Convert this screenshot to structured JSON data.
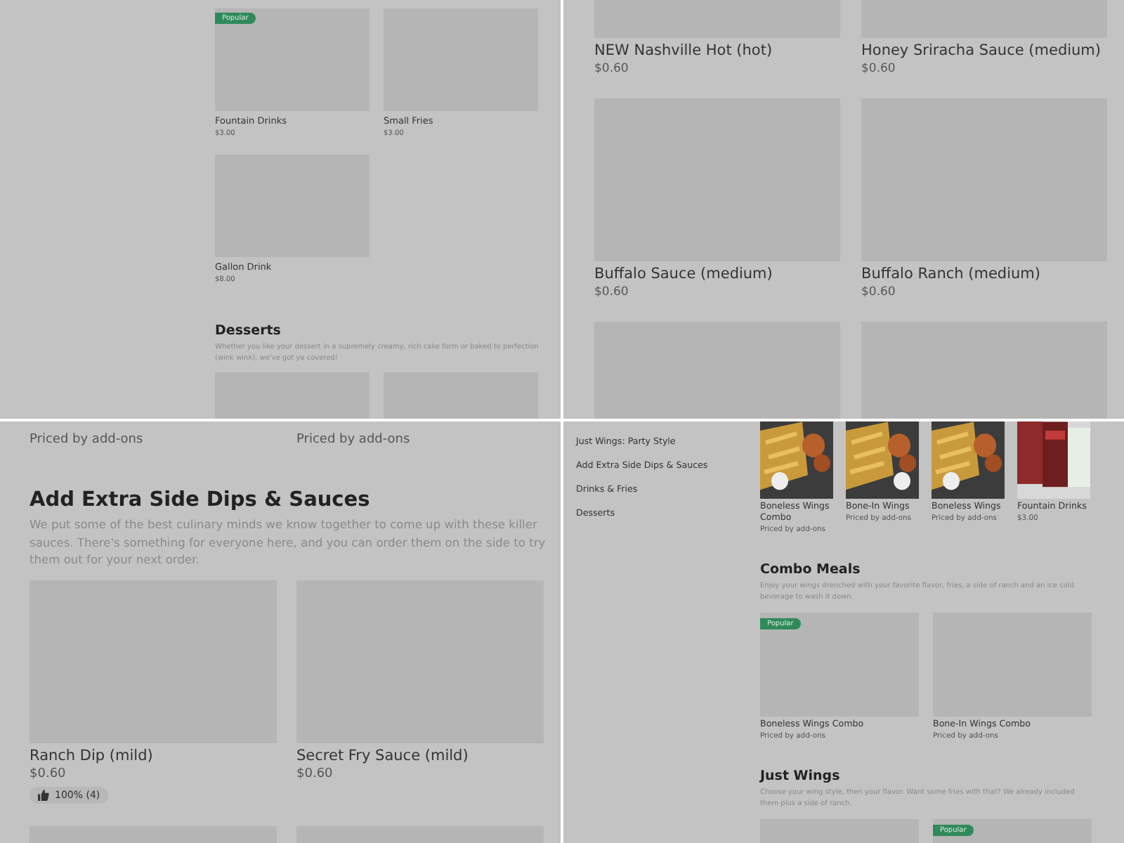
{
  "panels": [
    {
      "blocks": [
        {
          "kind": "cards",
          "items": [
            {
              "kind": "blank",
              "badge": "Popular",
              "title": "Fountain Drinks",
              "price": "$3.00"
            },
            {
              "kind": "blank",
              "title": "Small Fries",
              "price": "$3.00"
            },
            {
              "kind": "blank",
              "title": "Gallon Drink",
              "price": "$8.00"
            }
          ]
        },
        {
          "kind": "heading",
          "title": "Desserts",
          "description": "Whether you like your dessert in a supremely creamy, rich cake form or baked to perfection (wink wink), we've got ya covered!"
        },
        {
          "kind": "cards",
          "items": [
            {
              "kind": "blank"
            },
            {
              "kind": "blank"
            }
          ]
        }
      ]
    },
    {
      "blocks": [
        {
          "kind": "cards",
          "items": [
            {
              "kind": "blank",
              "title": "NEW Nashville Hot (hot)",
              "price": "$0.60"
            },
            {
              "kind": "blank",
              "title": "Honey Sriracha Sauce (medium)",
              "price": "$0.60"
            },
            {
              "kind": "blank",
              "title": "Buffalo Sauce (medium)",
              "price": "$0.60"
            },
            {
              "kind": "blank",
              "title": "Buffalo Ranch (medium)",
              "price": "$0.60"
            },
            {
              "kind": "blank"
            },
            {
              "kind": "blank"
            }
          ]
        }
      ]
    },
    {
      "blocks": [
        {
          "kind": "cards",
          "items": [
            {
              "price": "Priced by add-ons"
            },
            {
              "price": "Priced by add-ons"
            }
          ]
        },
        {
          "kind": "heading",
          "title": "Add Extra Side Dips & Sauces",
          "description": "We put some of the best culinary minds we know together to come up with these killer sauces. There's something for everyone here, and you can order them on the side to try them out for your next order."
        },
        {
          "kind": "cards",
          "items": [
            {
              "kind": "blank",
              "title": "Ranch Dip (mild)",
              "price": "$0.60",
              "rating": "100% (4)"
            },
            {
              "kind": "blank",
              "title": "Secret Fry Sauce (mild)",
              "price": "$0.60"
            },
            {
              "kind": "blank"
            },
            {
              "kind": "blank"
            }
          ]
        }
      ]
    },
    {
      "sidebar": [
        "Just Wings: Party Style",
        "Add Extra Side Dips & Sauces",
        "Drinks & Fries",
        "Desserts"
      ],
      "blocks": [
        {
          "kind": "carousel",
          "items": [
            {
              "kind": "picture",
              "title": "Boneless Wings Combo",
              "price": "Priced by add-ons"
            },
            {
              "kind": "picture",
              "title": "Bone-In Wings",
              "price": "Priced by add-ons"
            },
            {
              "kind": "picture",
              "title": "Boneless Wings",
              "price": "Priced by add-ons"
            },
            {
              "kind": "picture",
              "title": "Fountain Drinks",
              "price": "$3.00"
            }
          ]
        },
        {
          "kind": "heading",
          "title": "Combo Meals",
          "description": "Enjoy your wings drenched with your favorite flavor, fries, a side of ranch and an ice cold beverage to wash it down."
        },
        {
          "kind": "cards",
          "items": [
            {
              "kind": "blank",
              "badge": "Popular",
              "title": "Boneless Wings Combo",
              "price": "Priced by add-ons"
            },
            {
              "kind": "blank",
              "title": "Bone-In Wings Combo",
              "price": "Priced by add-ons"
            }
          ]
        },
        {
          "kind": "heading",
          "title": "Just Wings",
          "description": "Choose your wing style, then your flavor. Want some fries with that? We already included them plus a side of ranch."
        },
        {
          "kind": "cards",
          "items": [
            {
              "kind": "blank"
            },
            {
              "kind": "blank",
              "badge": "Popular"
            }
          ]
        }
      ]
    }
  ]
}
